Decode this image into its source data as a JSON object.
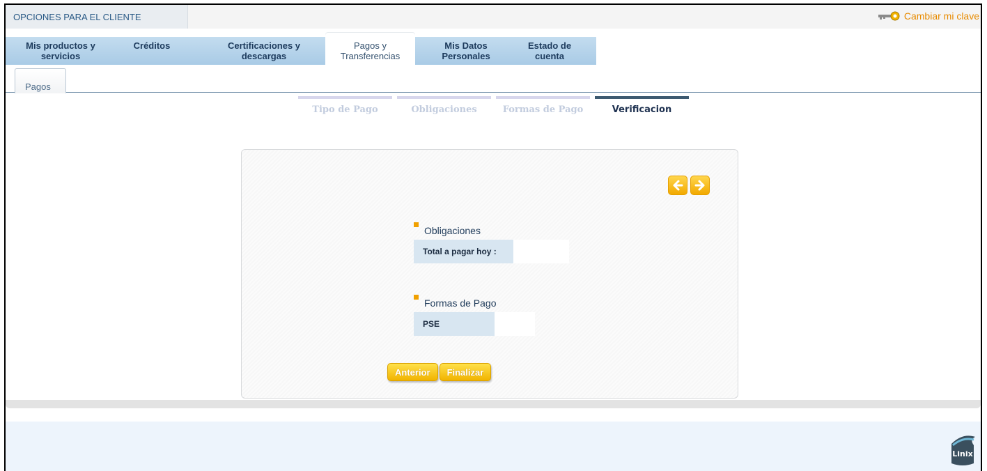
{
  "header": {
    "client_tab": "OPCIONES PARA EL CLIENTE",
    "change_key": "Cambiar mi clave"
  },
  "nav": {
    "items": [
      {
        "line1": "Mis productos y",
        "line2": "servicios"
      },
      {
        "line1": "Créditos",
        "line2": ""
      },
      {
        "line1": "Certificaciones y",
        "line2": "descargas"
      },
      {
        "line1": "Pagos y",
        "line2": "Transferencias"
      },
      {
        "line1": "Mis Datos",
        "line2": "Personales"
      },
      {
        "line1": "Estado de",
        "line2": "cuenta"
      }
    ],
    "active_index": 3
  },
  "subtab": {
    "label": "Pagos"
  },
  "steps": [
    {
      "label": "Tipo de Pago"
    },
    {
      "label": "Obligaciones"
    },
    {
      "label": "Formas de Pago"
    },
    {
      "label": "Verificacion"
    }
  ],
  "panel": {
    "obligations": {
      "title": "Obligaciones",
      "label": "Total a pagar hoy :",
      "value": ""
    },
    "payment_methods": {
      "title": "Formas de Pago",
      "label": "PSE",
      "value": ""
    },
    "buttons": {
      "previous": "Anterior",
      "finish": "Finalizar"
    }
  },
  "footer": {
    "logo_text": "Linix"
  },
  "colors": {
    "accent": "#f0a000",
    "nav_blue": "#aecfe8",
    "link_orange": "#e88b00"
  }
}
